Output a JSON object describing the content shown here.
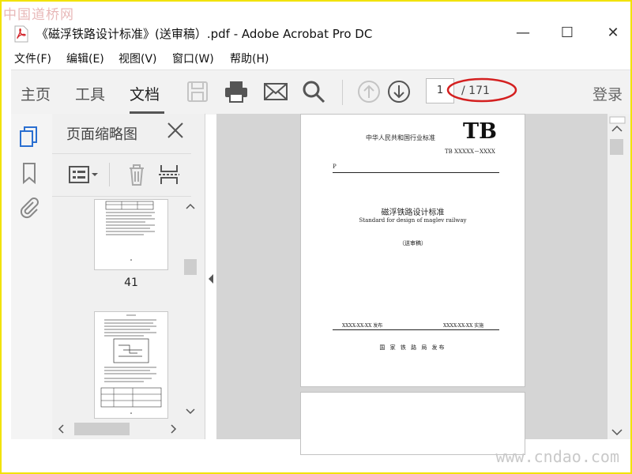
{
  "watermark": {
    "top": "中国道桥网",
    "bottom": "www.cndao.com"
  },
  "window": {
    "title": "《磁浮铁路设计标准》(送审稿）.pdf - Adobe Acrobat Pro DC",
    "minimize": "—",
    "maximize": "☐",
    "close": "✕"
  },
  "menu": {
    "items": [
      "文件(F)",
      "编辑(E)",
      "视图(V)",
      "窗口(W)",
      "帮助(H)"
    ]
  },
  "toolbar": {
    "tabs": [
      "主页",
      "工具",
      "文档"
    ],
    "active_tab": "文档",
    "icons": [
      "save-icon",
      "print-icon",
      "email-icon",
      "search-icon",
      "page-up-icon",
      "page-down-icon"
    ],
    "page_current": "1",
    "page_total": "/ 171",
    "login": "登录",
    "annotation_color": "#d42020"
  },
  "left_rail": {
    "icons": [
      "page-thumbnails-icon",
      "bookmark-icon",
      "attachment-icon"
    ],
    "accent": "#2a6fd1"
  },
  "thumb_panel": {
    "title": "页面缩略图",
    "tools": [
      "thumbnail-options-icon",
      "delete-page-icon",
      "insert-page-icon"
    ],
    "thumbs": [
      {
        "label": "41"
      },
      {
        "label": ""
      }
    ]
  },
  "document": {
    "issuer": "中华人民共和国行业标准",
    "code_big": "TB",
    "code": "TB XXXXX－XXXX",
    "p_mark": "P",
    "title_cn": "磁浮铁路设计标准",
    "title_en": "Standard for design of maglev railway",
    "draft": "（送审稿）",
    "release": "XXXX-XX-XX  发布",
    "effective": "XXXX-XX-XX  实施",
    "publisher": "国 家 铁 路 局      发布"
  }
}
